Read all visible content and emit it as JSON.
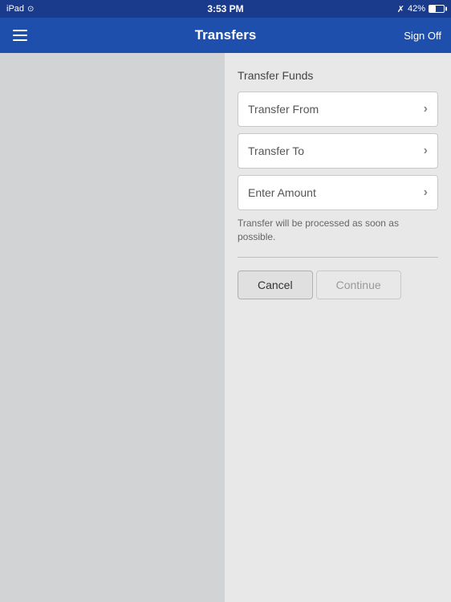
{
  "statusBar": {
    "device": "iPad",
    "time": "3:53 PM",
    "bluetooth": "42%",
    "battery_percent": "42%"
  },
  "navBar": {
    "title": "Transfers",
    "signOffLabel": "Sign Off",
    "menuIcon": "hamburger-icon"
  },
  "page": {
    "sectionTitle": "Transfer Funds",
    "fields": [
      {
        "label": "Transfer From",
        "placeholder": "Transfer From"
      },
      {
        "label": "Transfer To",
        "placeholder": "Transfer To"
      },
      {
        "label": "Enter Amount",
        "placeholder": "Enter Amount"
      }
    ],
    "infoText": "Transfer will be processed as soon as possible.",
    "cancelLabel": "Cancel",
    "continueLabel": "Continue"
  }
}
